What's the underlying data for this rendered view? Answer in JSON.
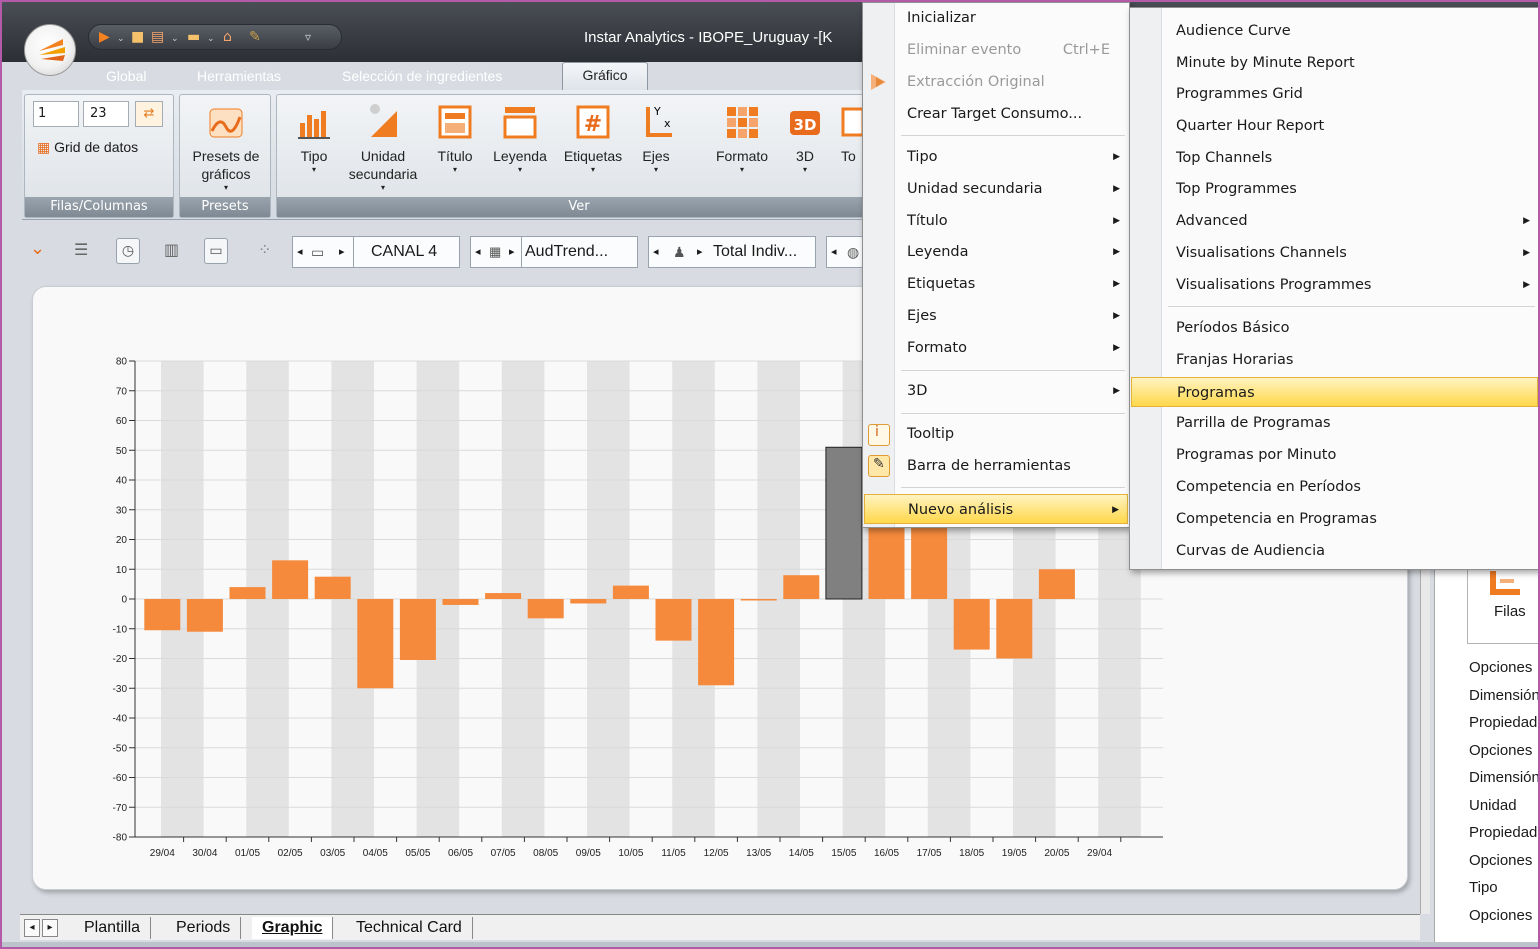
{
  "window": {
    "title": "Instar Analytics - IBOPE_Uruguay -[K"
  },
  "qat": {
    "more": "▿"
  },
  "ribbon_tabs": [
    "Global",
    "Herramientas",
    "Selección de ingredientes",
    "Gráfico"
  ],
  "ribbon": {
    "filas_columnas": {
      "rows": "1",
      "cols": "23",
      "grid_label": "Grid de datos",
      "group_label": "Filas/Columnas"
    },
    "presets": {
      "button": "Presets de gráficos",
      "group_label": "Presets"
    },
    "ver": {
      "group_label": "Ver",
      "buttons": [
        {
          "label": "Tipo",
          "dropdown": true
        },
        {
          "label": "Unidad secundaria",
          "dropdown": true
        },
        {
          "label": "Título",
          "dropdown": true
        },
        {
          "label": "Leyenda",
          "dropdown": true
        },
        {
          "label": "Etiquetas",
          "dropdown": true
        },
        {
          "label": "Ejes",
          "dropdown": true
        },
        {
          "label": "Formato",
          "dropdown": true
        },
        {
          "label": "3D",
          "dropdown": true
        },
        {
          "label": "To",
          "dropdown": false
        }
      ],
      "icon_texts": {
        "title_hash": "#",
        "threed": "3D",
        "axis_y": "Y",
        "axis_x": "x"
      }
    }
  },
  "toolbar2": {
    "canal": "CANAL 4",
    "variable": "AudTrend...",
    "target": "Total Indiv..."
  },
  "chart_data": {
    "type": "bar",
    "title": "",
    "xlabel": "",
    "ylabel": "",
    "ylim": [
      -80,
      80
    ],
    "yticks": [
      80,
      70,
      60,
      50,
      40,
      30,
      20,
      10,
      0,
      -10,
      -20,
      -30,
      -40,
      -50,
      -60,
      -70,
      -80
    ],
    "categories": [
      "29/04",
      "30/04",
      "01/05",
      "02/05",
      "03/05",
      "04/05",
      "05/05",
      "06/05",
      "07/05",
      "08/05",
      "09/05",
      "10/05",
      "11/05",
      "12/05",
      "13/05",
      "14/05",
      "15/05",
      "16/05",
      "17/05",
      "18/05",
      "19/05",
      "20/05",
      "29/04"
    ],
    "values": [
      -10.5,
      -11,
      4,
      13,
      7.5,
      -30,
      -20.5,
      -2,
      2,
      -6.5,
      -1.5,
      4.5,
      -14,
      -29,
      -0.5,
      8,
      51,
      28,
      28,
      -17,
      -20,
      10,
      0
    ],
    "highlight_index": 16,
    "colors": {
      "bar": "#f58a3c",
      "highlight": "#808080",
      "stripe": "#e3e3e3"
    },
    "grid": true
  },
  "sheet_tabs": [
    "Plantilla",
    "Periods",
    "Graphic",
    "Technical Card"
  ],
  "active_sheet": "Graphic",
  "right_panel": {
    "filas": "Filas",
    "rows": [
      "Opciones",
      "Dimensión",
      "Propiedad",
      "Opciones",
      "Dimensión",
      "Unidad",
      "Propiedad",
      "Opciones",
      "Tipo",
      "Opciones"
    ]
  },
  "context_menu": {
    "items": [
      {
        "label": "Inicializar"
      },
      {
        "label": "Eliminar evento",
        "shortcut": "Ctrl+E",
        "disabled": true
      },
      {
        "label": "Extracción Original",
        "disabled": true
      },
      {
        "label": "Crear Target Consumo..."
      },
      {
        "label": "Tipo",
        "submenu": true
      },
      {
        "label": "Unidad secundaria",
        "submenu": true
      },
      {
        "label": "Título",
        "submenu": true
      },
      {
        "label": "Leyenda",
        "submenu": true
      },
      {
        "label": "Etiquetas",
        "submenu": true
      },
      {
        "label": "Ejes",
        "submenu": true
      },
      {
        "label": "Formato",
        "submenu": true
      },
      {
        "label": "3D",
        "submenu": true
      },
      {
        "label": "Tooltip"
      },
      {
        "label": "Barra de herramientas"
      },
      {
        "label": "Nuevo análisis",
        "submenu": true,
        "highlighted": true
      }
    ]
  },
  "submenu": {
    "items": [
      {
        "label": "Audience Curve"
      },
      {
        "label": "Minute by Minute Report"
      },
      {
        "label": "Programmes Grid"
      },
      {
        "label": "Quarter Hour Report"
      },
      {
        "label": "Top Channels"
      },
      {
        "label": "Top Programmes"
      },
      {
        "label": "Advanced",
        "submenu": true
      },
      {
        "label": "Visualisations Channels",
        "submenu": true
      },
      {
        "label": "Visualisations Programmes",
        "submenu": true
      },
      {
        "label": "Períodos Básico"
      },
      {
        "label": "Franjas Horarias"
      },
      {
        "label": "Programas",
        "highlighted": true
      },
      {
        "label": "Parrilla de Programas"
      },
      {
        "label": "Programas por Minuto"
      },
      {
        "label": "Competencia en Períodos"
      },
      {
        "label": "Competencia en Programas"
      },
      {
        "label": "Curvas de Audiencia"
      }
    ]
  }
}
